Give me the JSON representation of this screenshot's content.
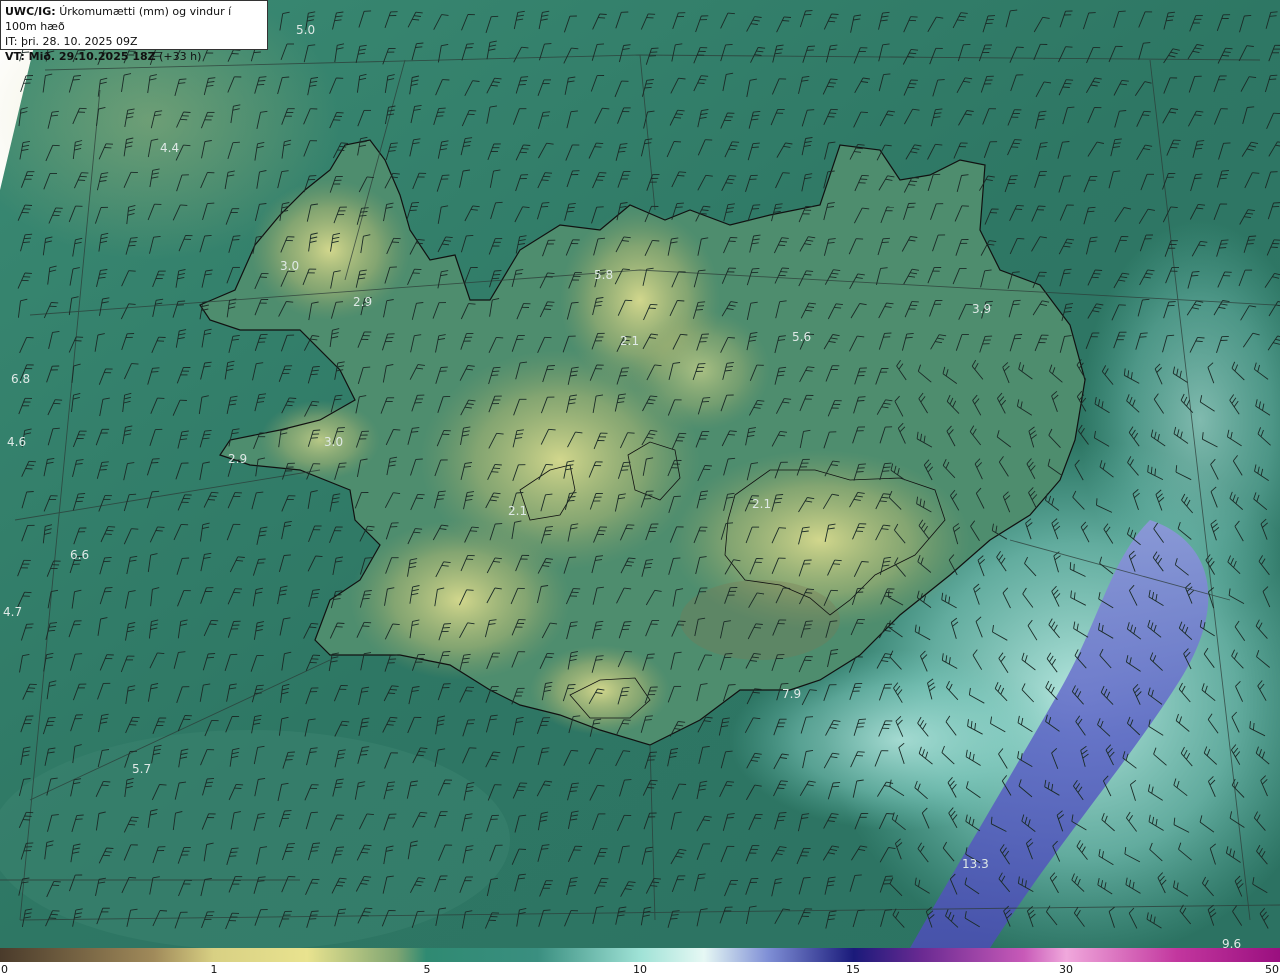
{
  "header": {
    "product": "UWC/IG:",
    "description": "Úrkomumætti (mm) og vindur í 100m hæð",
    "it_label": "IT:",
    "it_time": "þri. 28. 10. 2025 09Z",
    "vt_label": "VT: Mið. 29.10.2025 18Z",
    "vt_lead": "(+33 h)"
  },
  "map_values": [
    {
      "text": "5.0",
      "pos": "nw-sea"
    },
    {
      "text": "4.4",
      "pos": "west-sea"
    },
    {
      "text": "3.0",
      "pos": "westfjords"
    },
    {
      "text": "2.9",
      "pos": "westfjords-south"
    },
    {
      "text": "6.8",
      "pos": "west-edge"
    },
    {
      "text": "4.6",
      "pos": "west-edge"
    },
    {
      "text": "3.0",
      "pos": "snaefellsnes"
    },
    {
      "text": "2.9",
      "pos": "snaefellsnes-tip"
    },
    {
      "text": "6.6",
      "pos": "sw-sea"
    },
    {
      "text": "4.7",
      "pos": "sw-edge"
    },
    {
      "text": "5.8",
      "pos": "north"
    },
    {
      "text": "2.1",
      "pos": "north-inland"
    },
    {
      "text": "5.6",
      "pos": "northeast"
    },
    {
      "text": "3.9",
      "pos": "east"
    },
    {
      "text": "2.1",
      "pos": "vatnajokull"
    },
    {
      "text": "2.1",
      "pos": "langjokull"
    },
    {
      "text": "7.9",
      "pos": "south-coast"
    },
    {
      "text": "5.7",
      "pos": "south-sea"
    },
    {
      "text": "13.3",
      "pos": "se-sea"
    },
    {
      "text": "9.6",
      "pos": "se-corner"
    }
  ],
  "colorbar": {
    "ticks": [
      "0",
      "1",
      "5",
      "10",
      "15",
      "30",
      "50"
    ],
    "stops": [
      "#4a3b2b",
      "#b8a064",
      "#e9e38f",
      "#2f8a72",
      "#2d6e62",
      "#7fd6c9",
      "#dff6f1",
      "#3d4fa8",
      "#1a1a7a",
      "#b83aa8",
      "#ffb0e0",
      "#b01a8a"
    ]
  },
  "colors": {
    "sea_base": "#2f7a66",
    "land_low": "#e3de8c",
    "heavy_precip": "#5e68c4",
    "wind_barb": "#1b2b27"
  }
}
